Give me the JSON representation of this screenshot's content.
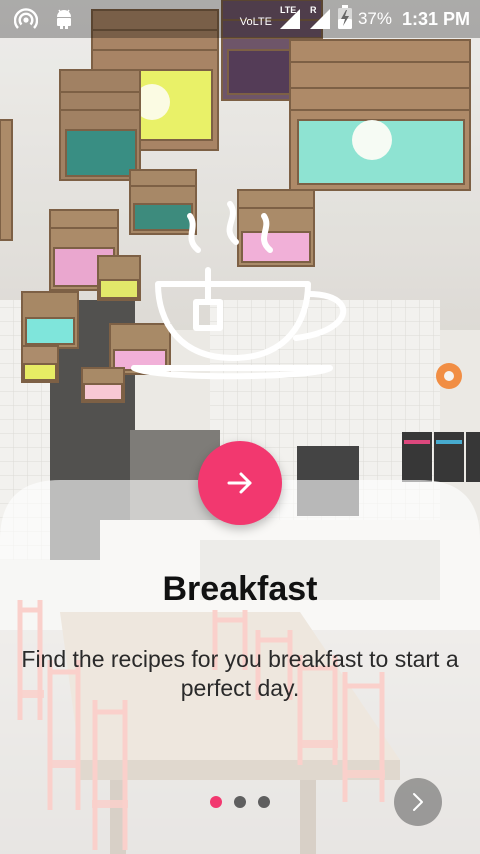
{
  "status_bar": {
    "volte": "VoLTE",
    "lte": "LTE",
    "roaming": "R",
    "battery": "37%",
    "time": "1:31 PM",
    "icons": [
      "hotspot-icon",
      "android-icon",
      "signal-lte-icon",
      "signal-roaming-icon",
      "battery-charging-icon"
    ]
  },
  "onboarding": {
    "title": "Breakfast",
    "description": "Find the recipes for you breakfast to start a perfect day.",
    "illustration": "tea-cup-icon",
    "primary_action_icon": "arrow-right-icon",
    "secondary_action_icon": "chevron-right-icon",
    "pages": 3,
    "current_page": 1
  },
  "colors": {
    "accent": "#f2386f",
    "dot_inactive": "#5f5f5f"
  }
}
